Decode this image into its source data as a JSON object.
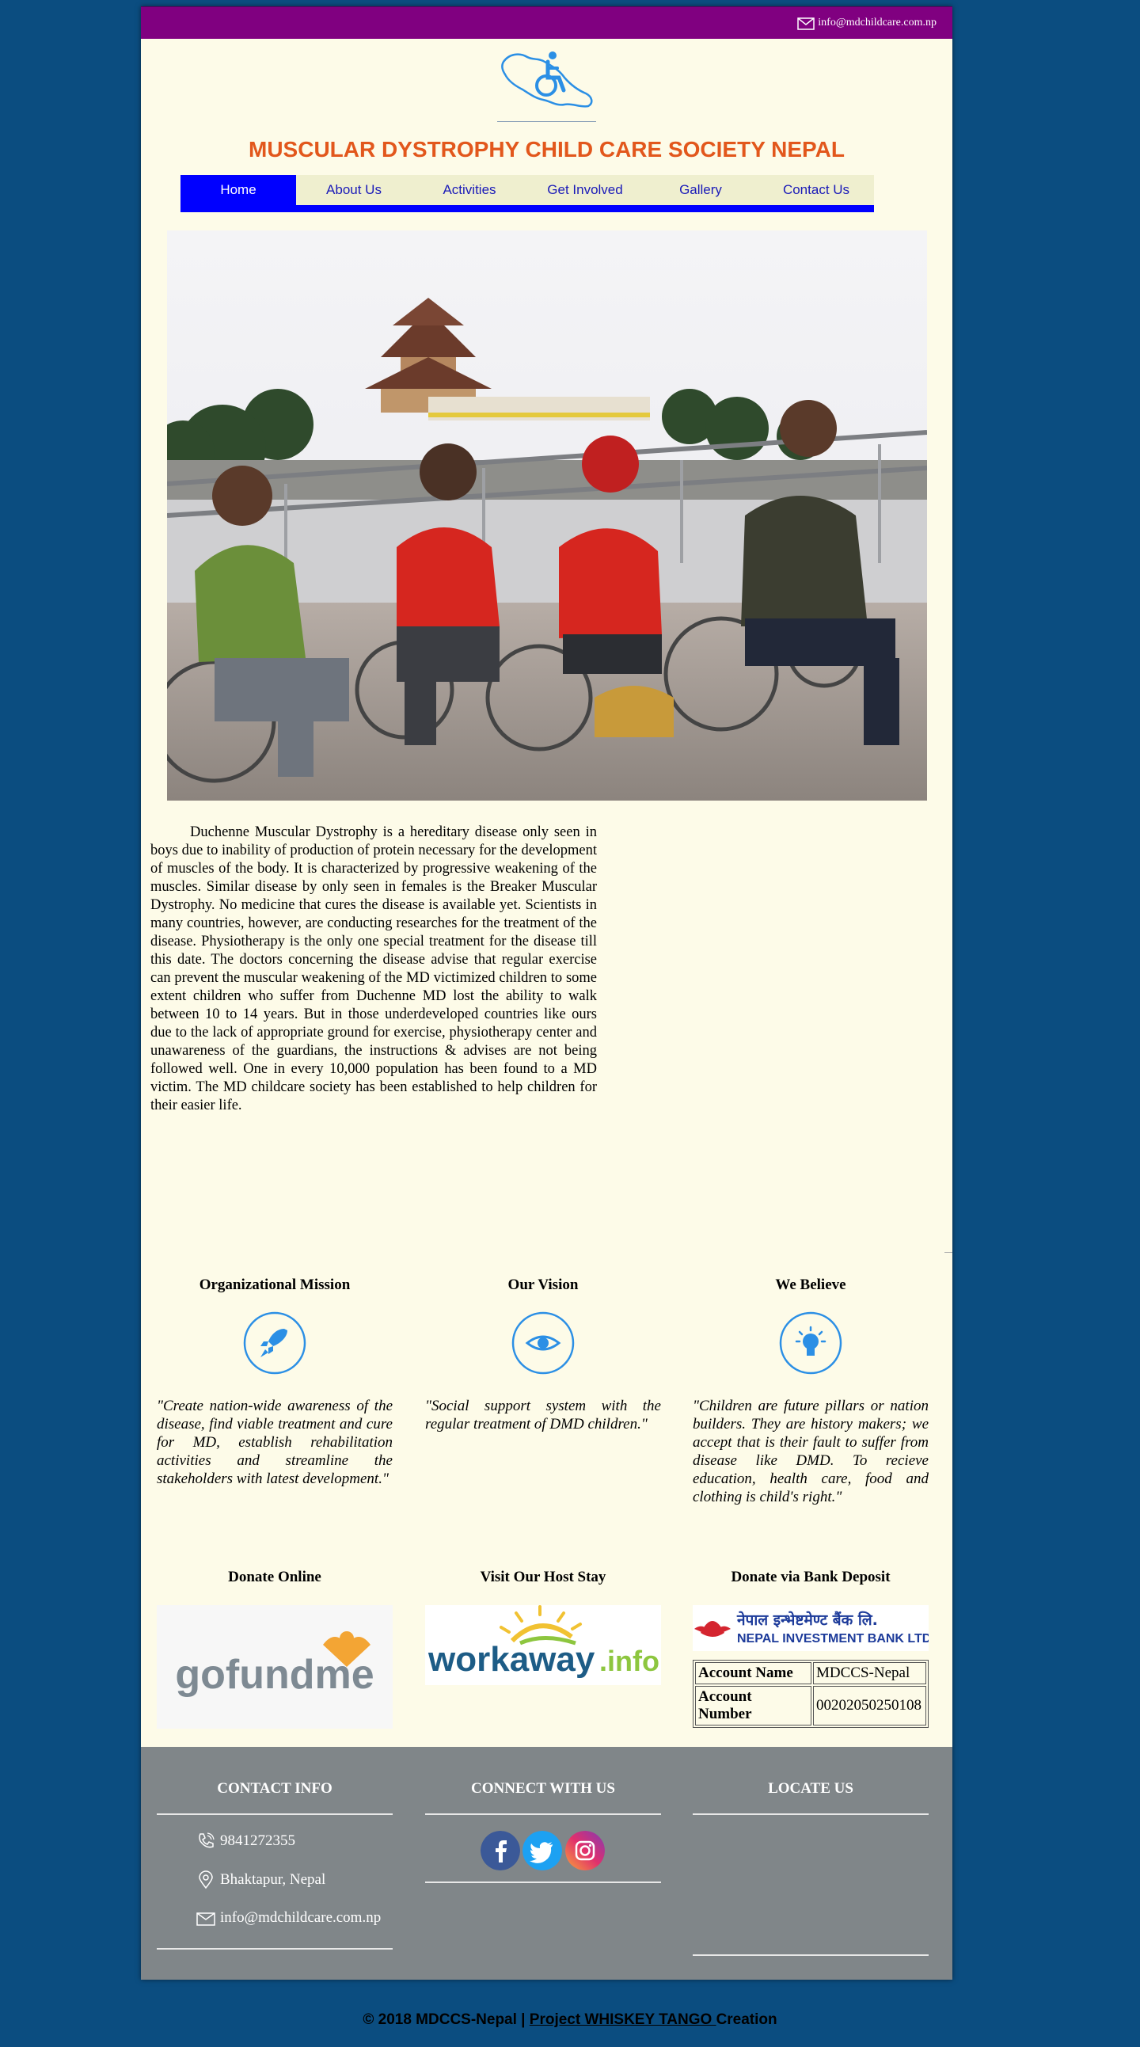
{
  "header": {
    "email": "info@mdchildcare.com.np",
    "title": "MUSCULAR DYSTROPHY CHILD CARE SOCIETY NEPAL"
  },
  "nav": {
    "items": [
      {
        "label": "Home",
        "active": true
      },
      {
        "label": "About Us"
      },
      {
        "label": "Activities"
      },
      {
        "label": "Get Involved"
      },
      {
        "label": "Gallery"
      },
      {
        "label": "Contact Us"
      }
    ]
  },
  "intro": {
    "text": "Duchenne Muscular Dystrophy is a hereditary disease only seen in boys due to inability of production of protein necessary for the development of muscles of the body. It is characterized by progressive weakening of the muscles. Similar disease by only seen in females is the Breaker Muscular Dystrophy. No medicine that cures the disease is available yet. Scientists in many countries, however, are conducting researches for the treatment of the disease. Physiotherapy is the only one special treatment for the disease till this date. The doctors concerning the disease advise that regular exercise can prevent the muscular weakening of the MD victimized children to some extent children who suffer from Duchenne MD lost the ability to walk between 10 to 14 years. But in those underdeveloped countries like ours due to the lack of appropriate ground for exercise, physiotherapy center and unawareness of the guardians, the instructions & advises are not being followed well. One in every 10,000 population has been found to a MD victim. The MD childcare society has been established to help children for their easier life."
  },
  "columns": [
    {
      "title": "Organizational Mission",
      "icon": "rocket-icon",
      "quote": "\"Create nation-wide awareness of the disease, find viable treatment and cure for MD, establish rehabilitation activities and streamline the stakeholders with latest development.\""
    },
    {
      "title": "Our Vision",
      "icon": "eye-icon",
      "quote": "\"Social support system with the regular treatment of DMD children.\""
    },
    {
      "title": "We Believe",
      "icon": "lightbulb-icon",
      "quote": "\"Children are future pillars or nation builders. They are history makers; we accept that is their fault to suffer from disease like DMD. To recieve education, health care, food and clothing is child's right.\""
    }
  ],
  "donate": {
    "online_title": "Donate Online",
    "gofundme_text": "gofundme",
    "hoststay_title": "Visit Our Host Stay",
    "workaway_text_1": "workaway",
    "workaway_text_2": ".info",
    "bank_title": "Donate via Bank Deposit",
    "bank_logo_nepali": "नेपाल इन्भेष्टमेण्ट बैंक लि.",
    "bank_logo_english": "NEPAL INVESTMENT BANK LTD.",
    "account_name_label": "Account Name",
    "account_name_value": "MDCCS-Nepal",
    "account_number_label": "Account Number",
    "account_number_value": "00202050250108"
  },
  "footer": {
    "contact_title": "CONTACT INFO",
    "phone": "9841272355",
    "location": "Bhaktapur, Nepal",
    "email": "info@mdchildcare.com.np",
    "connect_title": "CONNECT WITH US",
    "locate_title": "LOCATE US"
  },
  "credit": {
    "prefix": "© 2018 MDCCS-Nepal | ",
    "link": "Project WHISKEY TANGO ",
    "suffix": "Creation"
  },
  "colors": {
    "topbar": "#800080",
    "title": "#e2571c",
    "nav_active": "#0000ff",
    "page_bg": "#fdfbe8",
    "body_bg": "#0b4d80",
    "footer_bg": "#808689",
    "icon_blue": "#2b8fe5"
  }
}
